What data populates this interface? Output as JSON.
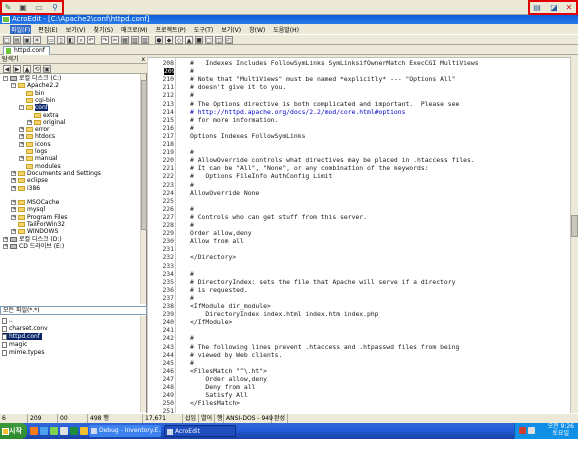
{
  "window": {
    "title": "AcroEdit - [C:\\Apache2\\conf\\httpd.conf]",
    "menu": [
      "파일(F)",
      "편집(E)",
      "보기(V)",
      "찾기(S)",
      "매크로(M)",
      "프로젝트(P)",
      "도구(T)",
      "보기(V)",
      "창(W)",
      "도움말(H)"
    ]
  },
  "tabs": [
    "httpd.conf"
  ],
  "explorer": {
    "title": "탐색기",
    "close": "x",
    "tree": [
      {
        "label": "로컬 디스크 (C:)",
        "level": 0,
        "kind": "drive",
        "exp": "-"
      },
      {
        "label": "Apache2.2",
        "level": 1,
        "kind": "folder",
        "exp": "-"
      },
      {
        "label": "bin",
        "level": 2,
        "kind": "folder",
        "exp": ""
      },
      {
        "label": "cgi-bin",
        "level": 2,
        "kind": "folder",
        "exp": ""
      },
      {
        "label": "conf",
        "level": 2,
        "kind": "folder",
        "exp": "-",
        "selected": true
      },
      {
        "label": "extra",
        "level": 3,
        "kind": "folder",
        "exp": ""
      },
      {
        "label": "original",
        "level": 3,
        "kind": "folder",
        "exp": "+"
      },
      {
        "label": "error",
        "level": 2,
        "kind": "folder",
        "exp": "+"
      },
      {
        "label": "htdocs",
        "level": 2,
        "kind": "folder",
        "exp": "+"
      },
      {
        "label": "icons",
        "level": 2,
        "kind": "folder",
        "exp": "+"
      },
      {
        "label": "logs",
        "level": 2,
        "kind": "folder",
        "exp": ""
      },
      {
        "label": "manual",
        "level": 2,
        "kind": "folder",
        "exp": "+"
      },
      {
        "label": "modules",
        "level": 2,
        "kind": "folder",
        "exp": ""
      },
      {
        "label": "Documents and Settings",
        "level": 1,
        "kind": "folder",
        "exp": "+"
      },
      {
        "label": "eclipse",
        "level": 1,
        "kind": "folder",
        "exp": "+"
      },
      {
        "label": "i386",
        "level": 1,
        "kind": "folder",
        "exp": "+"
      },
      {
        "label": "",
        "level": 1,
        "kind": "gap",
        "exp": ""
      },
      {
        "label": "MSOCache",
        "level": 1,
        "kind": "folder",
        "exp": "+"
      },
      {
        "label": "mysql",
        "level": 1,
        "kind": "folder",
        "exp": "+"
      },
      {
        "label": "Program Files",
        "level": 1,
        "kind": "folder",
        "exp": "+"
      },
      {
        "label": "TailForWin32",
        "level": 1,
        "kind": "folder",
        "exp": ""
      },
      {
        "label": "WINDOWS",
        "level": 1,
        "kind": "folder",
        "exp": "+"
      },
      {
        "label": "로컬 디스크 (D:)",
        "level": 0,
        "kind": "drive",
        "exp": "+"
      },
      {
        "label": "CD 드라이브 (E:)",
        "level": 0,
        "kind": "drive",
        "exp": "+"
      }
    ],
    "filter": "모든 파일(*.*)",
    "files": [
      {
        "label": "..",
        "selected": false
      },
      {
        "label": "charset.conv",
        "selected": false
      },
      {
        "label": "httpd.conf",
        "selected": true
      },
      {
        "label": "magic",
        "selected": false
      },
      {
        "label": "mime.types",
        "selected": false
      }
    ]
  },
  "editor": {
    "current_line": 209,
    "lines": [
      {
        "n": 208,
        "t": "#   Indexes Includes FollowSymLinks SymLinksifOwnerMatch ExecCGI MultiViews"
      },
      {
        "n": 209,
        "t": "#"
      },
      {
        "n": 210,
        "t": "# Note that \"MultiViews\" must be named *explicitly* --- \"Options All\""
      },
      {
        "n": 211,
        "t": "# doesn't give it to you."
      },
      {
        "n": 212,
        "t": "#"
      },
      {
        "n": 213,
        "t": "# The Options directive is both complicated and important.  Please see"
      },
      {
        "n": 214,
        "t": "# http://httpd.apache.org/docs/2.2/mod/core.html#options",
        "link": true
      },
      {
        "n": 215,
        "t": "# for more information."
      },
      {
        "n": 216,
        "t": "#"
      },
      {
        "n": 217,
        "t": "Options Indexes FollowSymLinks"
      },
      {
        "n": 218,
        "t": ""
      },
      {
        "n": 219,
        "t": "#"
      },
      {
        "n": 220,
        "t": "# AllowOverride controls what directives may be placed in .htaccess files."
      },
      {
        "n": 221,
        "t": "# It can be \"All\", \"None\", or any combination of the keywords:"
      },
      {
        "n": 222,
        "t": "#   Options FileInfo AuthConfig Limit"
      },
      {
        "n": 223,
        "t": "#"
      },
      {
        "n": 224,
        "t": "AllowOverride None"
      },
      {
        "n": 225,
        "t": ""
      },
      {
        "n": 226,
        "t": "#"
      },
      {
        "n": 227,
        "t": "# Controls who can get stuff from this server."
      },
      {
        "n": 228,
        "t": "#"
      },
      {
        "n": 229,
        "t": "Order allow,deny"
      },
      {
        "n": 230,
        "t": "Allow from all"
      },
      {
        "n": 231,
        "t": ""
      },
      {
        "n": 232,
        "t": "</Directory>"
      },
      {
        "n": 233,
        "t": ""
      },
      {
        "n": 234,
        "t": "#"
      },
      {
        "n": 235,
        "t": "# DirectoryIndex: sets the file that Apache will serve if a directory"
      },
      {
        "n": 236,
        "t": "# is requested."
      },
      {
        "n": 237,
        "t": "#"
      },
      {
        "n": 238,
        "t": "<IfModule dir_module>"
      },
      {
        "n": 239,
        "t": "    DirectoryIndex index.html index.htm index.php"
      },
      {
        "n": 240,
        "t": "</IfModule>"
      },
      {
        "n": 241,
        "t": ""
      },
      {
        "n": 242,
        "t": "#"
      },
      {
        "n": 243,
        "t": "# The following lines prevent .htaccess and .htpasswd files from being"
      },
      {
        "n": 244,
        "t": "# viewed by Web clients."
      },
      {
        "n": 245,
        "t": "#"
      },
      {
        "n": 246,
        "t": "<FilesMatch \"^\\.ht\">"
      },
      {
        "n": 247,
        "t": "    Order allow,deny"
      },
      {
        "n": 248,
        "t": "    Deny from all"
      },
      {
        "n": 249,
        "t": "    Satisfy All"
      },
      {
        "n": 250,
        "t": "</FilesMatch>"
      },
      {
        "n": 251,
        "t": ""
      }
    ]
  },
  "status": {
    "line": "6",
    "col": "209",
    "a": "00",
    "size": "498 행",
    "bytes": "17,671",
    "insert": "삽입",
    "col_mode": "열어",
    "line_mode": "행",
    "encoding": "ANSI-DOS - 949",
    "complete": "완성"
  },
  "taskbar": {
    "start": "시작",
    "items": [
      "Debug - Inventory.E...",
      "AcroEdit"
    ],
    "active_item": 1,
    "time": "오전 9:26",
    "day": "토요일"
  },
  "colors": {
    "title": "#0a5fd8",
    "taskbar": "#245edb",
    "highlight": "#e00000",
    "selection": "#0a246a"
  }
}
